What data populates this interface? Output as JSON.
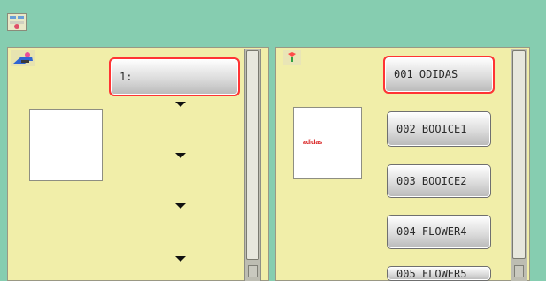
{
  "left": {
    "selector_label": "1:"
  },
  "right": {
    "patterns": [
      "001 ODIDAS",
      "002 BOOICE1",
      "003 BOOICE2",
      "004 FLOWER4",
      "005 FLOWER5"
    ],
    "preview_text": "adidas"
  }
}
